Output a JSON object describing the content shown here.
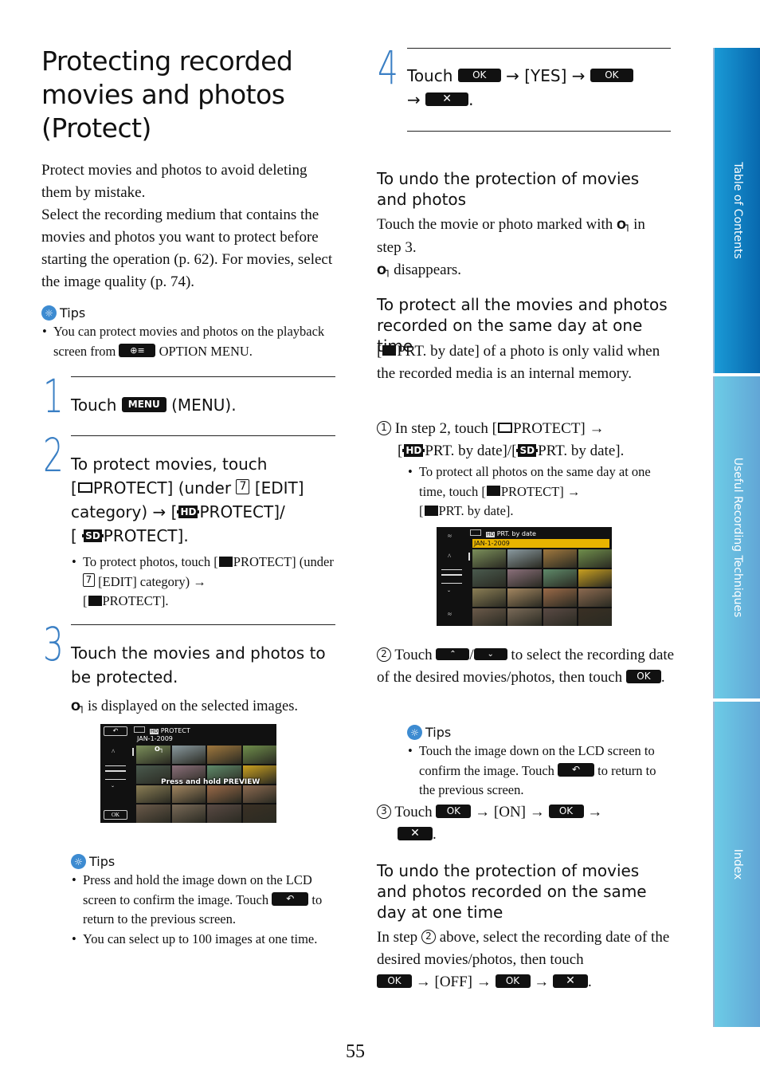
{
  "page": {
    "title": "Protecting recorded movies and photos (Protect)",
    "page_number": "55"
  },
  "intro": {
    "p1": "Protect movies and photos to avoid deleting them by mistake.",
    "p2": "Select the recording medium that contains the movies and photos you want to protect before starting the operation (p. 62). For movies, select the image quality (p. 74)."
  },
  "tips1": {
    "label": "Tips",
    "item1_a": "You can protect movies and photos on the playback screen from",
    "item1_b": "OPTION MENU."
  },
  "step1": {
    "num": "1",
    "text_a": "Touch",
    "menu_btn": "MENU",
    "text_b": "(MENU)."
  },
  "step2": {
    "num": "2",
    "l1": "To protect movies, touch",
    "l2_a": "[",
    "l2_b": "PROTECT] (under",
    "box": "7",
    "l2_c": "[EDIT]",
    "l3_a": "category) → [",
    "hd": "HD",
    "l3_b": "PROTECT]/",
    "l4_a": "[",
    "sd": "SD",
    "l4_b": "PROTECT].",
    "sub_a": "To protect photos, touch [",
    "sub_b": "PROTECT]",
    "sub_c": "(under",
    "sub_box": "7",
    "sub_d": "[EDIT] category) →",
    "sub_e": "[",
    "sub_f": "PROTECT]."
  },
  "step3": {
    "num": "3",
    "text": "Touch the movies and photos to be protected.",
    "key_note": "is displayed on the selected images."
  },
  "lcd1": {
    "back": "⮌",
    "header": "PROTECT",
    "hd": "HD",
    "date": "JAN-1-2009",
    "overlay": "Press and hold PREVIEW",
    "ok": "OK"
  },
  "tips2": {
    "label": "Tips",
    "item1_a": "Press and hold the image down on the LCD screen to confirm the image. Touch",
    "item1_b": "to return to the previous screen.",
    "item2": "You can select up to 100 images at one time."
  },
  "step4": {
    "num": "4",
    "touch": "Touch",
    "ok": "OK",
    "yes": "→ [YES] →",
    "arrow": "→",
    "x": "✕"
  },
  "undo1": {
    "heading": "To undo the protection of movies and photos",
    "p1_a": "Touch the movie or photo marked with",
    "p1_b": "in step 3.",
    "p2": "disappears."
  },
  "protect_all": {
    "heading": "To protect all the movies and photos recorded on the same day at one time",
    "p1": "[",
    "p1_b": "PRT. by date] of a photo is only valid when the recorded media is an internal memory.",
    "s1_num": "1",
    "s1_a": "In step 2, touch [",
    "s1_b": "PROTECT] →",
    "s1_c": "[",
    "hd": "HD",
    "s1_d": "PRT. by date]/[",
    "sd": "SD",
    "s1_e": "PRT. by date].",
    "s1_sub_a": "To protect all photos on the same day at one time, touch [",
    "s1_sub_b": "PROTECT] →",
    "s1_sub_c": "[",
    "s1_sub_d": "PRT. by date].",
    "s2_num": "2",
    "s2_a": "Touch",
    "up": "»",
    "slash": "/",
    "down": "«",
    "s2_b": "to select the recording date of the desired movies/photos, then touch",
    "ok": "OK",
    "tips_label": "Tips",
    "tips_a": "Touch the image down on the LCD screen to confirm the image. Touch",
    "tips_b": "to return to the previous screen.",
    "s3_num": "3",
    "s3_a": "Touch",
    "s3_on": "→ [ON] →",
    "s3_arrow": "→",
    "x": "✕"
  },
  "lcd2": {
    "header": "PRT. by date",
    "hd": "HD",
    "date": "JAN-1-2009"
  },
  "undo_all": {
    "heading": "To undo the protection of movies and photos recorded on the same day at one time",
    "p_a": "In step",
    "circ": "2",
    "p_b": "above, select the recording date of the desired movies/photos, then touch",
    "off": "→ [OFF] →",
    "arrow": "→",
    "ok": "OK",
    "x": "✕"
  },
  "sidebar": {
    "tabs": [
      {
        "label": "Table of Contents"
      },
      {
        "label": "Useful Recording Techniques"
      },
      {
        "label": "Index"
      }
    ]
  },
  "colors": {
    "accent": "#3a7fc4",
    "tab_active": "#0a75bb",
    "tab_inactive": "#67aed9",
    "lcd_date_highlight": "#e8b400"
  }
}
